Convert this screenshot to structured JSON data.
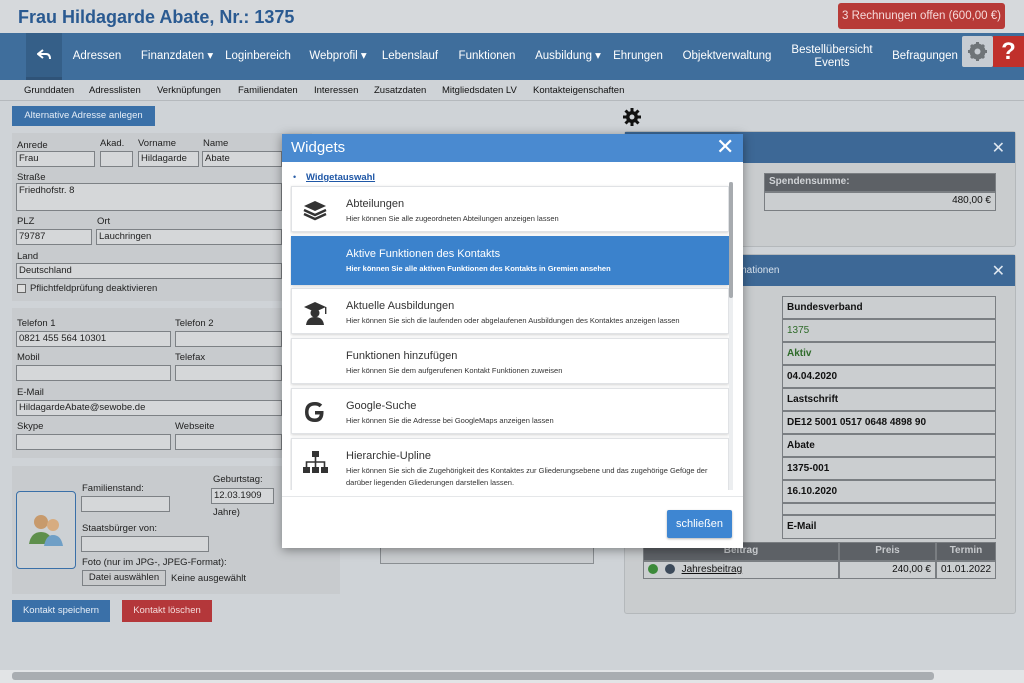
{
  "header": {
    "title": "Frau Hildagarde Abate, Nr.: 1375",
    "invoice_button": "3 Rechnungen offen (600,00 €)"
  },
  "nav": {
    "items": [
      "Adressen",
      "Finanzdaten ▾",
      "Loginbereich",
      "Webprofil ▾",
      "Lebenslauf",
      "Funktionen",
      "Ausbildung ▾",
      "Ehrungen",
      "Objektverwaltung",
      "Bestellübersicht Events",
      "Befragungen"
    ],
    "help": "?"
  },
  "subnav": {
    "items": [
      "Grunddaten",
      "Adresslisten",
      "Verknüpfungen",
      "Familiendaten",
      "Interessen",
      "Zusatzdaten",
      "Mitgliedsdaten LV",
      "Kontakteigenschaften"
    ]
  },
  "form": {
    "alt_address_button": "Alternative Adresse anlegen",
    "anrede_label": "Anrede",
    "anrede_value": "Frau",
    "akad_label": "Akad.",
    "akad_value": "",
    "vorname_label": "Vorname",
    "vorname_value": "Hildagarde",
    "name_label": "Name",
    "name_value": "Abate",
    "strasse_label": "Straße",
    "strasse_value": "Friedhofstr. 8",
    "plz_label": "PLZ",
    "plz_value": "79787",
    "ort_label": "Ort",
    "ort_value": "Lauchringen",
    "land_label": "Land",
    "land_value": "Deutschland",
    "pflicht_label": "Pflichtfeldprüfung deaktivieren",
    "telefon1_label": "Telefon 1",
    "telefon1_value": "0821 455 564 10301",
    "telefon2_label": "Telefon 2",
    "mobil_label": "Mobil",
    "telefax_label": "Telefax",
    "email_label": "E-Mail",
    "email_value": "HildagardeAbate@sewobe.de",
    "skype_label": "Skype",
    "webseite_label": "Webseite",
    "familienstand_label": "Familienstand:",
    "geburtstag_label": "Geburtstag:",
    "geburtstag_value": "12.03.1909",
    "jahre_suffix": "Jahre)",
    "staatsbuerger_label": "Staatsbürger von:",
    "foto_label": "Foto (nur im JPG-, JPEG-Format):",
    "datei_button": "Datei auswählen",
    "datei_status": "Keine ausgewählt",
    "save_button": "Kontakt speichern",
    "delete_button": "Kontakt löschen"
  },
  "right": {
    "spenden_header": "Spendensumme:",
    "spenden_value": "480,00 €",
    "info_title": "rmationen",
    "info_rows": [
      "Bundesverband",
      "1375",
      "Aktiv",
      "04.04.2020",
      "Lastschrift",
      "DE12 5001 0517 0648 4898 90",
      "Abate",
      "1375-001",
      "16.10.2020",
      "",
      "E-Mail"
    ],
    "beitrag_headers": [
      "Beitrag",
      "Preis",
      "Termin"
    ],
    "beitrag_row": [
      "Jahresbeitrag",
      "240,00 €",
      "01.01.2022"
    ]
  },
  "modal": {
    "title": "Widgets",
    "breadcrumb": "Widgetauswahl",
    "close_button": "schließen",
    "items": [
      {
        "title": "Abteilungen",
        "desc": "Hier können Sie alle zugeordneten Abteilungen anzeigen lassen",
        "icon": "layers-icon"
      },
      {
        "title": "Aktive Funktionen des Kontakts",
        "desc": "Hier können Sie alle aktiven Funktionen des Kontakts in Gremien ansehen",
        "icon": ""
      },
      {
        "title": "Aktuelle Ausbildungen",
        "desc": "Hier können Sie sich die laufenden oder abgelaufenen Ausbildungen des Kontaktes anzeigen lassen",
        "icon": "graduate-icon"
      },
      {
        "title": "Funktionen hinzufügen",
        "desc": "Hier können Sie dem aufgerufenen Kontakt Funktionen zuweisen",
        "icon": ""
      },
      {
        "title": "Google-Suche",
        "desc": "Hier können Sie die Adresse bei GoogleMaps anzeigen lassen",
        "icon": "google-icon"
      },
      {
        "title": "Hierarchie-Upline",
        "desc": "Hier können Sie sich die Zugehörigkeit des Kontaktes zur Gliederungsebene und das zugehörige Gefüge der darüber liegenden Gliederungen darstellen lassen.",
        "icon": "hierarchy-icon"
      }
    ]
  }
}
